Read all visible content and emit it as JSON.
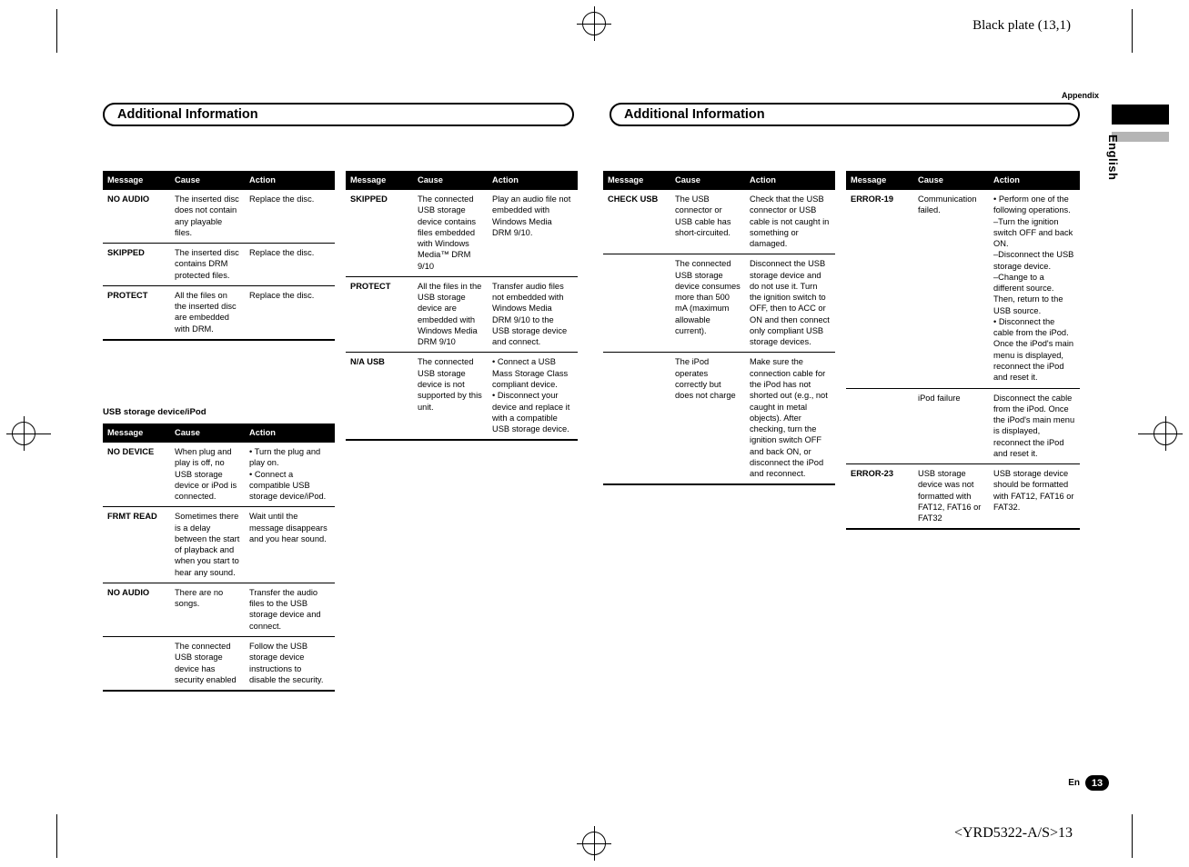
{
  "page": {
    "black_plate": "Black plate (13,1)",
    "footer_code": "<YRD5322-A/S>13",
    "page_number": "13",
    "page_lang": "En",
    "appendix_label": "Appendix",
    "english_tab": "English"
  },
  "sections": {
    "left_title": "Additional Information",
    "right_title": "Additional Information",
    "usb_subhead": "USB storage device/iPod"
  },
  "columns": {
    "message": "Message",
    "cause": "Cause",
    "action": "Action"
  },
  "tables": {
    "t1": {
      "rows": [
        {
          "msg": "NO AUDIO",
          "cause": "The inserted disc does not contain any playable files.",
          "action": "Replace the disc."
        },
        {
          "msg": "SKIPPED",
          "cause": "The inserted disc contains DRM protected files.",
          "action": "Replace the disc."
        },
        {
          "msg": "PROTECT",
          "cause": "All the files on the inserted disc are embedded with DRM.",
          "action": "Replace the disc."
        }
      ]
    },
    "t2": {
      "rows": [
        {
          "msg": "NO DEVICE",
          "cause": "When plug and play is off, no USB storage device or iPod is connected.",
          "action": "• Turn the plug and play on.\n• Connect a compatible USB storage device/iPod."
        },
        {
          "msg": "FRMT READ",
          "cause": "Sometimes there is a delay between the start of playback and when you start to hear any sound.",
          "action": "Wait until the message disappears and you hear sound."
        },
        {
          "msg": "NO AUDIO",
          "cause": "There are no songs.",
          "action": "Transfer the audio files to the USB storage device and connect."
        },
        {
          "msg": "",
          "cause": "The connected USB storage device has security enabled",
          "action": "Follow the USB storage device instructions to disable the security."
        }
      ]
    },
    "t3": {
      "rows": [
        {
          "msg": "SKIPPED",
          "cause": "The connected USB storage device contains files embedded with Windows Media™ DRM 9/10",
          "action": "Play an audio file not embedded with Windows Media DRM 9/10."
        },
        {
          "msg": "PROTECT",
          "cause": "All the files in the USB storage device are embedded with Windows Media DRM 9/10",
          "action": "Transfer audio files not embedded with Windows Media DRM 9/10 to the USB storage device and connect."
        },
        {
          "msg": "N/A USB",
          "cause": "The connected USB storage device is not supported by this unit.",
          "action": "• Connect a USB Mass Storage Class compliant device.\n• Disconnect your device and replace it with a compatible USB storage device."
        }
      ]
    },
    "t4": {
      "rows": [
        {
          "msg": "CHECK USB",
          "cause": "The USB connector or USB cable has short-circuited.",
          "action": "Check that the USB connector or USB cable is not caught in something or damaged."
        },
        {
          "msg": "",
          "cause": "The connected USB storage device consumes more than 500 mA (maximum allowable current).",
          "action": "Disconnect the USB storage device and do not use it. Turn the ignition switch to OFF, then to ACC or ON and then connect only compliant USB storage devices."
        },
        {
          "msg": "",
          "cause": "The iPod operates correctly but does not charge",
          "action": "Make sure the connection cable for the iPod has not shorted out (e.g., not caught in metal objects). After checking, turn the ignition switch OFF and back ON, or disconnect the iPod and reconnect."
        }
      ]
    },
    "t5": {
      "rows": [
        {
          "msg": "ERROR-19",
          "cause": "Communication failed.",
          "action": "• Perform one of the following operations.\n–Turn the ignition switch OFF and back ON.\n–Disconnect the USB storage device.\n–Change to a different source. Then, return to the USB source.\n• Disconnect the cable from the iPod. Once the iPod's main menu is displayed, reconnect the iPod and reset it."
        },
        {
          "msg": "",
          "cause": "iPod failure",
          "action": "Disconnect the cable from the iPod. Once the iPod's main menu is displayed, reconnect the iPod and reset it."
        },
        {
          "msg": "ERROR-23",
          "cause": "USB storage device was not formatted with FAT12, FAT16 or FAT32",
          "action": "USB storage device should be formatted with FAT12, FAT16 or FAT32."
        }
      ]
    }
  }
}
